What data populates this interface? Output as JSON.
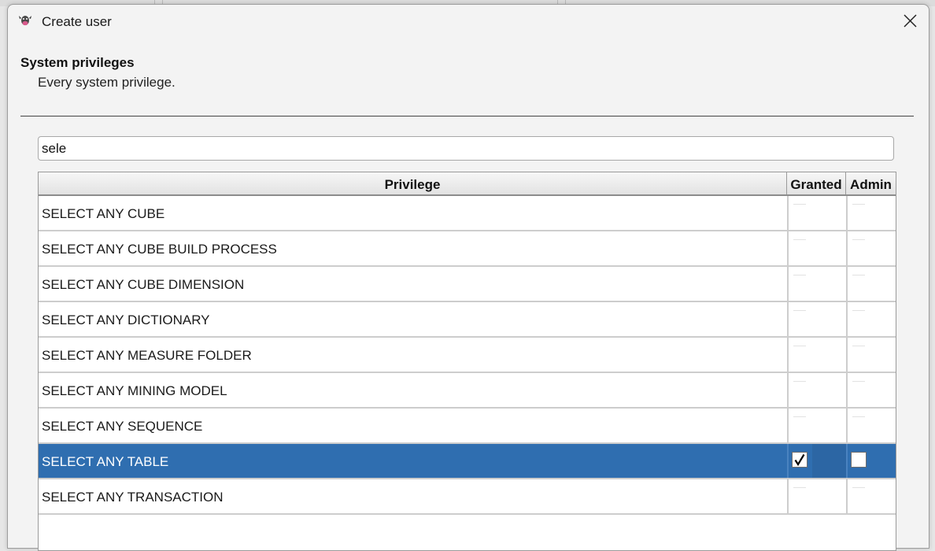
{
  "window": {
    "title": "Create user",
    "icon": "cow-icon",
    "close_icon": "close-icon"
  },
  "section": {
    "title": "System privileges",
    "description": "Every system privilege."
  },
  "filter": {
    "value": "sele",
    "placeholder": ""
  },
  "table": {
    "columns": {
      "privilege": "Privilege",
      "granted": "Granted",
      "admin": "Admin"
    },
    "rows": [
      {
        "privilege": "SELECT ANY CUBE",
        "granted": false,
        "admin": false,
        "selected": false
      },
      {
        "privilege": "SELECT ANY CUBE BUILD PROCESS",
        "granted": false,
        "admin": false,
        "selected": false
      },
      {
        "privilege": "SELECT ANY CUBE DIMENSION",
        "granted": false,
        "admin": false,
        "selected": false
      },
      {
        "privilege": "SELECT ANY DICTIONARY",
        "granted": false,
        "admin": false,
        "selected": false
      },
      {
        "privilege": "SELECT ANY MEASURE FOLDER",
        "granted": false,
        "admin": false,
        "selected": false
      },
      {
        "privilege": "SELECT ANY MINING MODEL",
        "granted": false,
        "admin": false,
        "selected": false
      },
      {
        "privilege": "SELECT ANY SEQUENCE",
        "granted": false,
        "admin": false,
        "selected": false
      },
      {
        "privilege": "SELECT ANY TABLE",
        "granted": true,
        "admin": false,
        "selected": true
      },
      {
        "privilege": "SELECT ANY TRANSACTION",
        "granted": false,
        "admin": false,
        "selected": false
      }
    ]
  },
  "colors": {
    "selection": "#2f6eb0",
    "dialog_bg": "#f3f3f3"
  }
}
